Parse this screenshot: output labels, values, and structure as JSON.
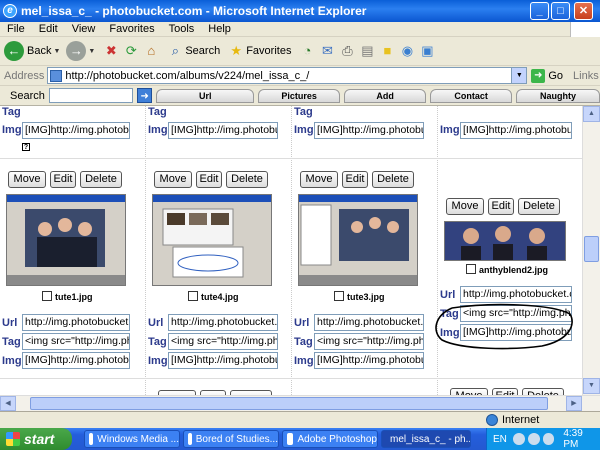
{
  "window": {
    "title": "mel_issa_c_ - photobucket.com - Microsoft Internet Explorer"
  },
  "menu": [
    "File",
    "Edit",
    "View",
    "Favorites",
    "Tools",
    "Help"
  ],
  "toolbar": {
    "back": "Back",
    "search": "Search",
    "favorites": "Favorites"
  },
  "address": {
    "label": "Address",
    "url": "http://photobucket.com/albums/v224/mel_issa_c_/",
    "go": "Go",
    "links": "Links"
  },
  "searchbar": {
    "label": "Search",
    "tabs": [
      "Url",
      "Pictures",
      "Add",
      "Contact",
      "Naughty"
    ]
  },
  "labels": {
    "url": "Url",
    "tag": "Tag",
    "img": "Img"
  },
  "buttons": {
    "move": "Move",
    "edit": "Edit",
    "delete": "Delete"
  },
  "fields": {
    "url_value": "http://img.photobucket.c",
    "tag_value": "<img src=\"http://img.pho",
    "img_value": "[IMG]http://img.photobuc",
    "tag_value_wide": "<img src=\"http://img.photo",
    "img_value_wide": "[IMG]http://img.photobuc"
  },
  "photos": [
    {
      "filename": "tute1.jpg"
    },
    {
      "filename": "tute4.jpg"
    },
    {
      "filename": "tute3.jpg"
    },
    {
      "filename": "anthyblend2.jpg"
    }
  ],
  "status": {
    "zone": "Internet"
  },
  "taskbar": {
    "start": "start",
    "tasks": [
      "Windows Media ...",
      "Bored of Studies...",
      "Adobe Photoshop",
      "mel_issa_c_ - ph..."
    ],
    "lang": "EN",
    "clock": "4:39 PM"
  }
}
